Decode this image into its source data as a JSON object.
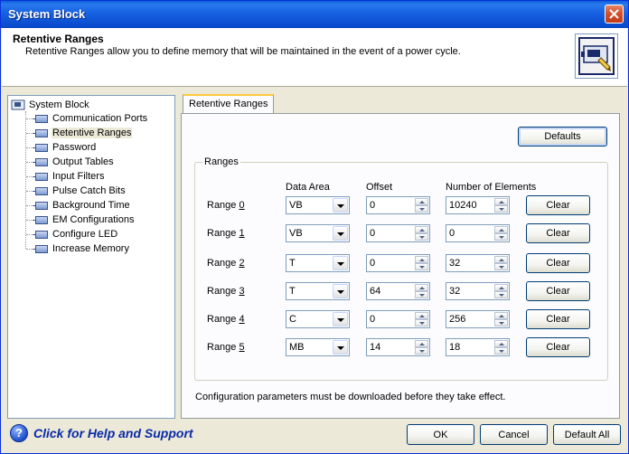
{
  "window": {
    "title": "System Block"
  },
  "header": {
    "title": "Retentive Ranges",
    "description": "Retentive Ranges allow you to define memory that will be maintained in the event of a power cycle."
  },
  "tree": {
    "root": "System Block",
    "items": [
      {
        "label": "Communication Ports"
      },
      {
        "label": "Retentive Ranges",
        "selected": true
      },
      {
        "label": "Password"
      },
      {
        "label": "Output Tables"
      },
      {
        "label": "Input Filters"
      },
      {
        "label": "Pulse Catch Bits"
      },
      {
        "label": "Background Time"
      },
      {
        "label": "EM Configurations"
      },
      {
        "label": "Configure LED"
      },
      {
        "label": "Increase Memory"
      }
    ]
  },
  "tab": {
    "label": "Retentive Ranges"
  },
  "panel": {
    "defaults_label": "Defaults",
    "group_label": "Ranges",
    "columns": {
      "data_area": "Data Area",
      "offset": "Offset",
      "elements": "Number of Elements"
    },
    "clear_label": "Clear",
    "ranges": [
      {
        "label": "Range ",
        "num": "0",
        "area": "VB",
        "offset": "0",
        "elements": "10240"
      },
      {
        "label": "Range ",
        "num": "1",
        "area": "VB",
        "offset": "0",
        "elements": "0"
      },
      {
        "label": "Range ",
        "num": "2",
        "area": "T",
        "offset": "0",
        "elements": "32"
      },
      {
        "label": "Range ",
        "num": "3",
        "area": "T",
        "offset": "64",
        "elements": "32"
      },
      {
        "label": "Range ",
        "num": "4",
        "area": "C",
        "offset": "0",
        "elements": "256"
      },
      {
        "label": "Range ",
        "num": "5",
        "area": "MB",
        "offset": "14",
        "elements": "18"
      }
    ],
    "footnote": "Configuration parameters must be downloaded before they take effect."
  },
  "footer": {
    "help_text": "Click for Help and Support",
    "ok_label": "OK",
    "cancel_label": "Cancel",
    "default_all_label": "Default All"
  },
  "colors": {
    "title_bar": "#0a5fd6",
    "window_bg": "#ece9d8",
    "help_text": "#0a2aa8"
  },
  "icons": {
    "close": "close-icon",
    "header": "system-block-icon",
    "help": "help-icon",
    "tree_node": "plc-module-icon"
  }
}
